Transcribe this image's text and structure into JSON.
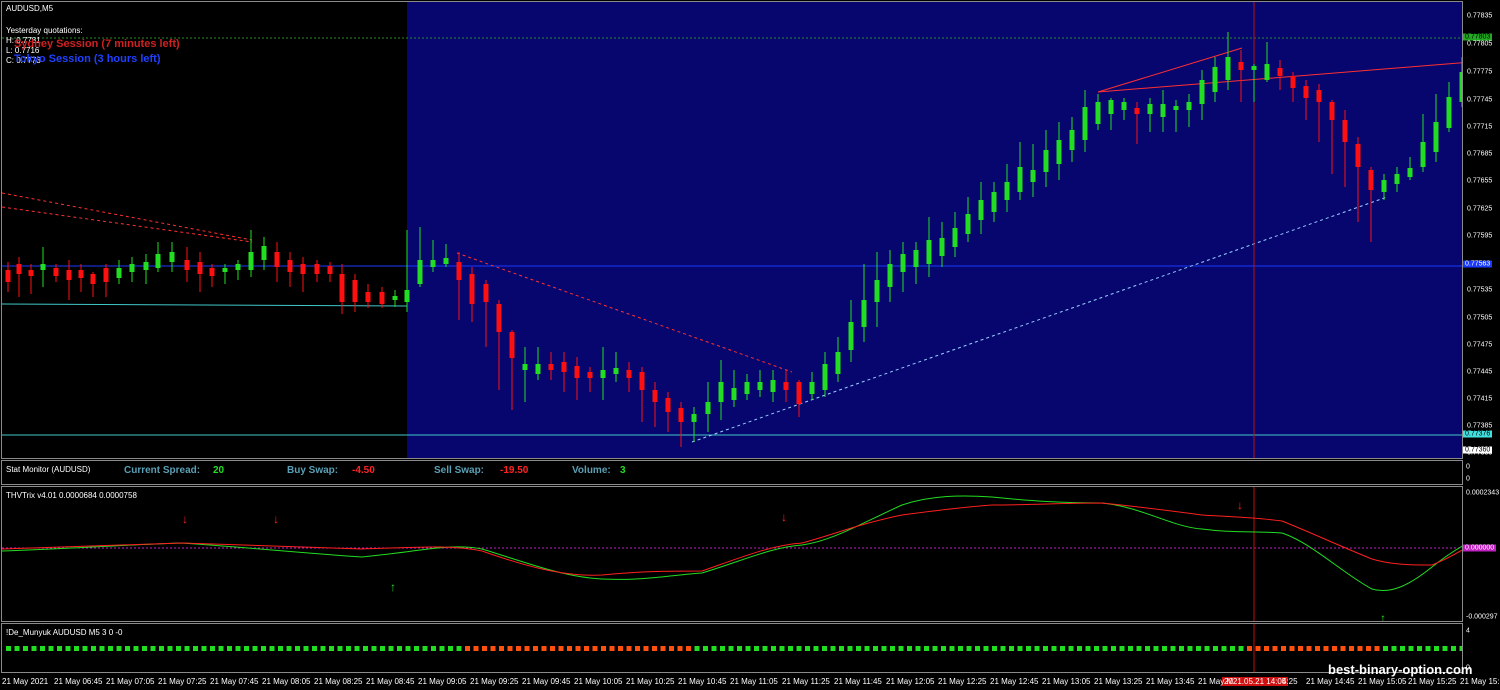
{
  "main_chart": {
    "title": "AUDUSD,M5",
    "quote_header": "Yesterday quotations:",
    "high": "H: 0.7781",
    "low": "L: 0.7716",
    "close": "C: 0.7773",
    "session1": "Sydney Session (7 minutes left)",
    "session2": "Tokyo Session (3 hours left)",
    "price_ticks": [
      "0.77835",
      "0.77805",
      "0.77775",
      "0.77745",
      "0.77715",
      "0.77685",
      "0.77655",
      "0.77625",
      "0.77595",
      "0.77535",
      "0.77505",
      "0.77475",
      "0.77445",
      "0.77415",
      "0.77385",
      "0.77355"
    ],
    "tag_green": "0.77803",
    "tag_blue": "0.77563",
    "tag_cyan": "0.77376",
    "tag_white": "0.77360",
    "colors": {
      "bull": "#22dd22",
      "bear": "#ff1010",
      "session_bg": "#06066e",
      "cyan": "#40c8c8"
    }
  },
  "stat_monitor": {
    "title": "Stat Monitor (AUDUSD)",
    "spread_label": "Current Spread:",
    "spread_value": "20",
    "buy_label": "Buy Swap:",
    "buy_value": "-4.50",
    "sell_label": "Sell Swap:",
    "sell_value": "-19.50",
    "volume_label": "Volume:",
    "volume_value": "3",
    "axis_top": "0",
    "axis_bottom": "0"
  },
  "trix": {
    "title": "THVTrix v4.01 0.0000684 0.0000758",
    "axis_top": "0.0002343",
    "axis_zero": "0.000000",
    "axis_bottom": "-0.000297"
  },
  "munyuk": {
    "title": "!De_Munyuk AUDUSD M5 3 0 -0",
    "axis_top": "4",
    "axis_bottom": "0"
  },
  "time_axis": {
    "labels": [
      "21 May 2021",
      "21 May 06:45",
      "21 May 07:05",
      "21 May 07:25",
      "21 May 07:45",
      "21 May 08:05",
      "21 May 08:25",
      "21 May 08:45",
      "21 May 09:05",
      "21 May 09:25",
      "21 May 09:45",
      "21 May 10:05",
      "21 May 10:25",
      "21 May 10:45",
      "21 May 11:05",
      "21 May 11:25",
      "21 May 11:45",
      "21 May 12:05",
      "21 May 12:25",
      "21 May 12:45",
      "21 May 13:05",
      "21 May 13:25",
      "21 May 13:45",
      "21 May M",
      "4:25",
      "21 May 14:45",
      "21 May 15:05",
      "21 May 15:25",
      "21 May 15:"
    ],
    "cursor_label": "2021.05.21 14:05"
  },
  "watermark": "best-binary-option.com"
}
